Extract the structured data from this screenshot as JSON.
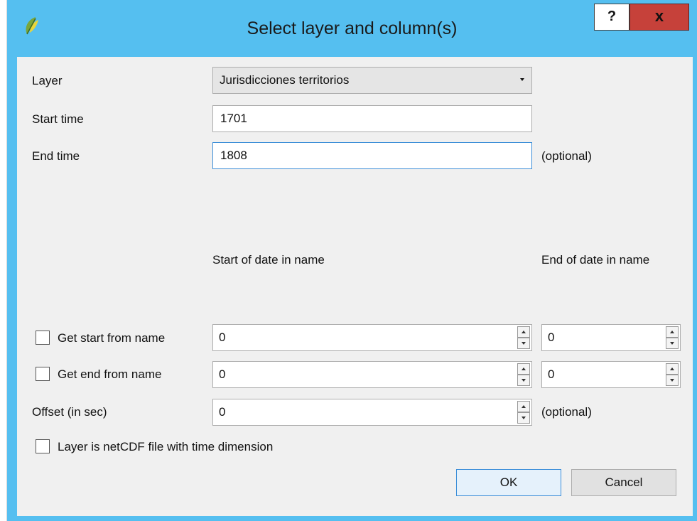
{
  "window": {
    "title": "Select layer and column(s)",
    "help_label": "?",
    "close_label": "x",
    "icon": "qgis-icon"
  },
  "form": {
    "layer_label": "Layer",
    "layer_value": "Jurisdicciones territorios",
    "start_time_label": "Start time",
    "start_time_value": "1701",
    "end_time_label": "End time",
    "end_time_value": "1808",
    "end_time_hint": "(optional)",
    "start_of_date_header": "Start of date in name",
    "end_of_date_header": "End of date in name",
    "get_start_label": "Get start from name",
    "get_start_from": "0",
    "get_start_to": "0",
    "get_end_label": "Get end from name",
    "get_end_from": "0",
    "get_end_to": "0",
    "offset_label": "Offset (in sec)",
    "offset_value": "0",
    "offset_hint": "(optional)",
    "netcdf_label": "Layer is netCDF file with time dimension"
  },
  "buttons": {
    "ok": "OK",
    "cancel": "Cancel"
  },
  "colors": {
    "titlebar": "#55bff0",
    "close_button": "#c6413a",
    "client": "#f0f0f0",
    "focus": "#3c8ed8"
  }
}
